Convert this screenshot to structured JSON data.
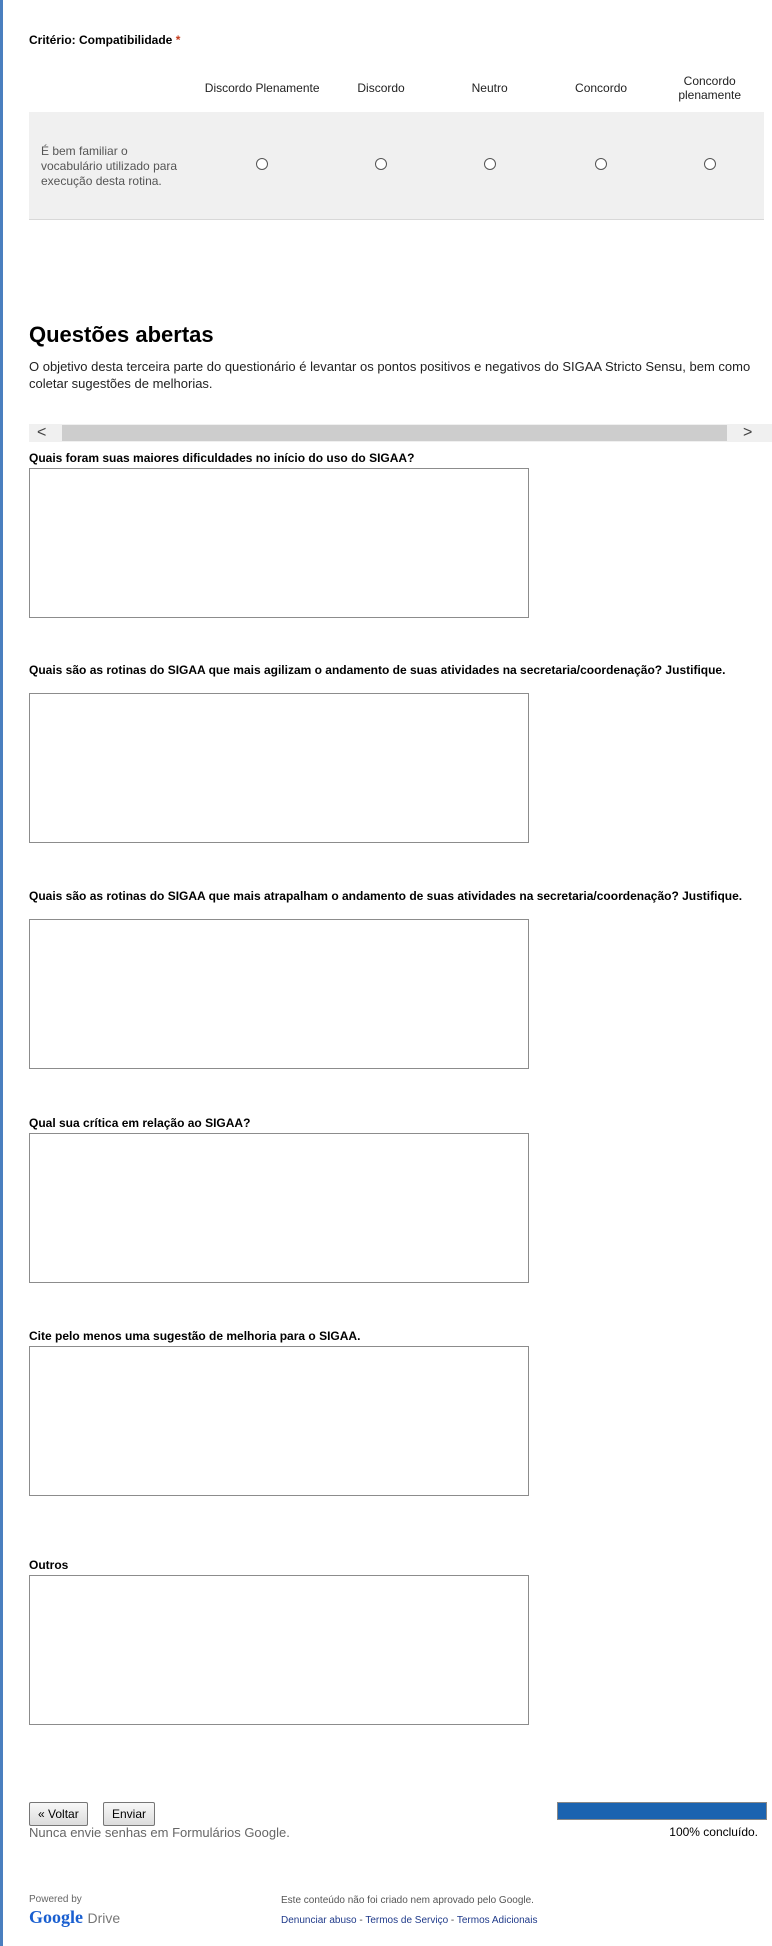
{
  "grid": {
    "title": "Critério: Compatibilidade",
    "required_mark": "*",
    "columns": [
      "Discordo Plenamente",
      "Discordo",
      "Neutro",
      "Concordo",
      "Concordo plenamente"
    ],
    "rows": [
      {
        "label": "É bem familiar o vocabulário utilizado para execução desta rotina."
      }
    ]
  },
  "section": {
    "title": "Questões abertas",
    "description": "O objetivo desta terceira parte do questionário é levantar os pontos positivos e negativos do SIGAA Stricto Sensu, bem como coletar sugestões de melhorias."
  },
  "scrollbar": {
    "left_arrow": "<",
    "right_arrow": ">"
  },
  "questions": [
    {
      "label": "Quais foram suas maiores dificuldades no início do uso do SIGAA?",
      "value": ""
    },
    {
      "label": "Quais são as rotinas do SIGAA que mais agilizam o andamento de suas atividades na secretaria/coordenação? Justifique.",
      "value": ""
    },
    {
      "label": "Quais são as rotinas do SIGAA que mais atrapalham o andamento de suas atividades na secretaria/coordenação? Justifique.",
      "value": ""
    },
    {
      "label": "Qual sua crítica em relação ao SIGAA?",
      "value": ""
    },
    {
      "label": "Cite pelo menos uma sugestão de melhoria para o SIGAA.",
      "value": ""
    },
    {
      "label": "Outros",
      "value": ""
    }
  ],
  "navigation": {
    "back_label": "« Voltar",
    "submit_label": "Enviar",
    "password_warning": "Nunca envie senhas em Formulários Google."
  },
  "progress": {
    "percent": 100,
    "label": "100% concluído."
  },
  "footer": {
    "powered_by": "Powered by",
    "brand_google": "Google",
    "brand_drive": "Drive",
    "notice": "Este conteúdo não foi criado nem aprovado pelo Google.",
    "links": [
      "Denunciar abuso",
      "Termos de Serviço",
      "Termos Adicionais"
    ],
    "link_separator": " - "
  },
  "colors": {
    "accent": "#1b63b0",
    "required": "#c43b1d",
    "frame": "#4a7fbf"
  }
}
